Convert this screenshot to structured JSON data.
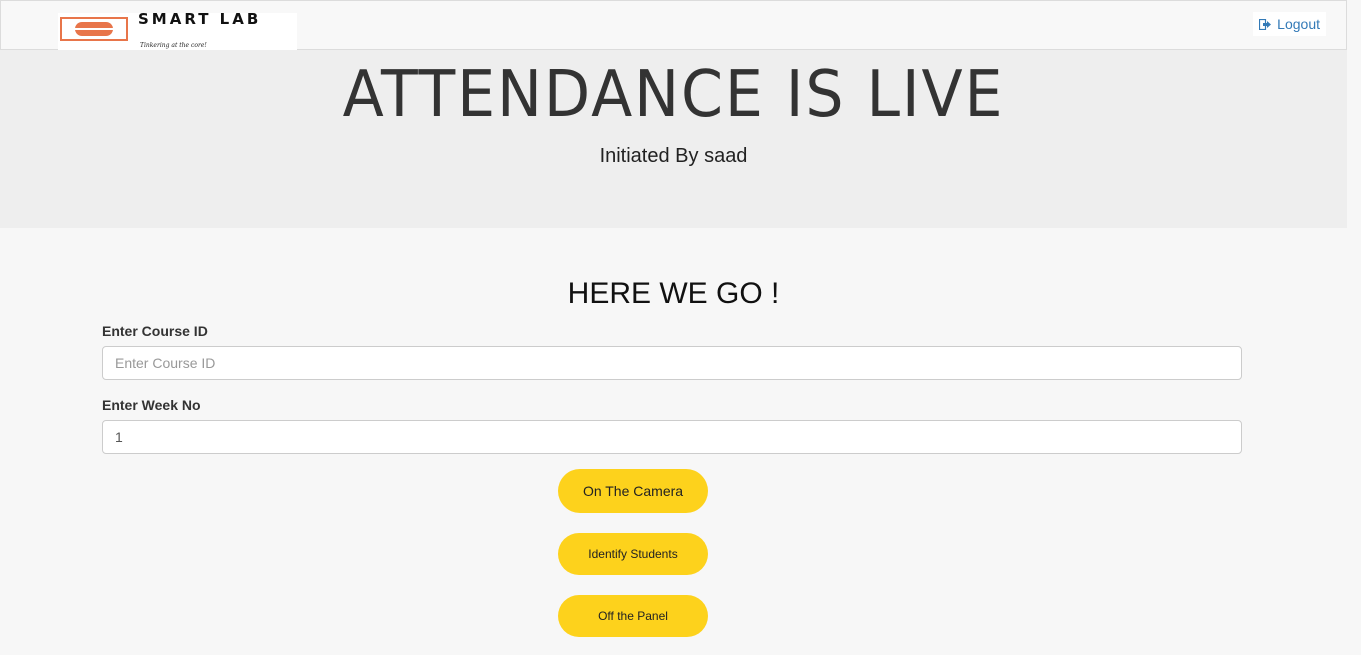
{
  "navbar": {
    "logo": {
      "brand": "SMART LAB",
      "tagline": "Tinkering at the core!"
    },
    "logout_label": "Logout"
  },
  "header": {
    "title": "ATTENDANCE IS LIVE",
    "subtitle": "Initiated By saad"
  },
  "main": {
    "title": "HERE WE GO !",
    "course_id": {
      "label": "Enter Course ID",
      "placeholder": "Enter Course ID",
      "value": ""
    },
    "week_no": {
      "label": "Enter Week No",
      "value": "1"
    },
    "buttons": {
      "camera_on": "On The Camera",
      "identify": "Identify Students",
      "panel_off": "Off the Panel"
    }
  },
  "colors": {
    "accent_button": "#fdd21c",
    "link": "#337ab7",
    "logo_orange": "#e8754a"
  }
}
